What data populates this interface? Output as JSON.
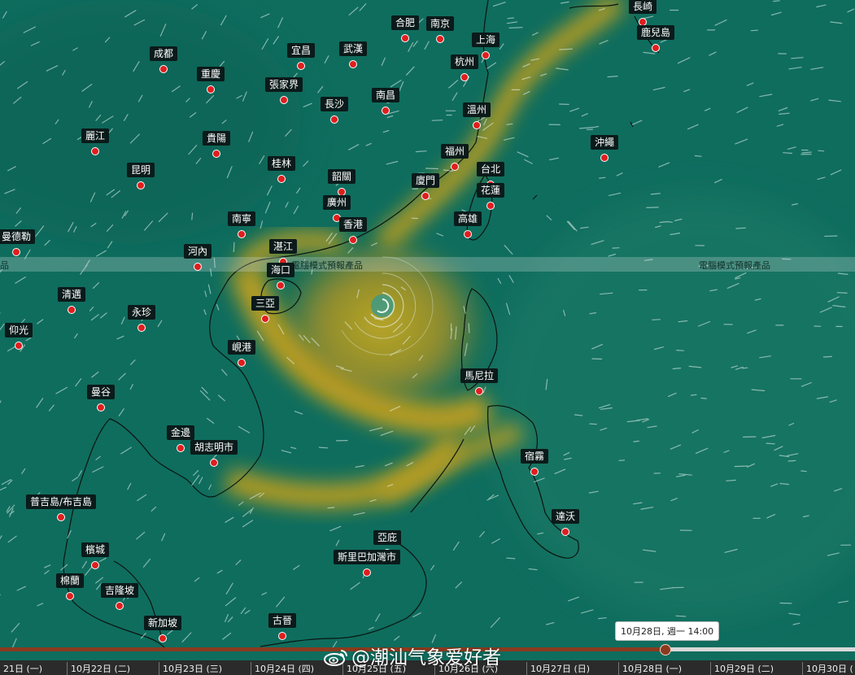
{
  "colors": {
    "ocean": "#0f6d5e",
    "strong_wind": "#c9a21a",
    "city_dot": "#e01e1e",
    "label_bg": "#0b1a1a",
    "timeline_played": "#8a3a1e"
  },
  "banner": {
    "left_text": "電腦模式預報產品",
    "right_text": "電腦模式預報產品",
    "edge_text": "品"
  },
  "cities": [
    {
      "name": "合肥"
    },
    {
      "name": "南京"
    },
    {
      "name": "長崎"
    },
    {
      "name": "鹿兒島"
    },
    {
      "name": "上海"
    },
    {
      "name": "成都"
    },
    {
      "name": "宜昌"
    },
    {
      "name": "武漢"
    },
    {
      "name": "杭州"
    },
    {
      "name": "重慶"
    },
    {
      "name": "張家界"
    },
    {
      "name": "南昌"
    },
    {
      "name": "長沙"
    },
    {
      "name": "溫州"
    },
    {
      "name": "麗江"
    },
    {
      "name": "貴陽"
    },
    {
      "name": "沖繩"
    },
    {
      "name": "福州"
    },
    {
      "name": "昆明"
    },
    {
      "name": "桂林"
    },
    {
      "name": "韶關"
    },
    {
      "name": "台北"
    },
    {
      "name": "廈門"
    },
    {
      "name": "廣州"
    },
    {
      "name": "花蓮"
    },
    {
      "name": "南寧"
    },
    {
      "name": "香港"
    },
    {
      "name": "高雄"
    },
    {
      "name": "曼德勒"
    },
    {
      "name": "河內"
    },
    {
      "name": "湛江"
    },
    {
      "name": "海口"
    },
    {
      "name": "清邁"
    },
    {
      "name": "三亞"
    },
    {
      "name": "永珍"
    },
    {
      "name": "仰光"
    },
    {
      "name": "峴港"
    },
    {
      "name": "馬尼拉"
    },
    {
      "name": "曼谷"
    },
    {
      "name": "金邊"
    },
    {
      "name": "胡志明市"
    },
    {
      "name": "宿霧"
    },
    {
      "name": "普吉島/布吉島"
    },
    {
      "name": "達沃"
    },
    {
      "name": "亞庇"
    },
    {
      "name": "檳城"
    },
    {
      "name": "斯里巴加灣市"
    },
    {
      "name": "棉蘭"
    },
    {
      "name": "吉隆坡"
    },
    {
      "name": "新加坡"
    },
    {
      "name": "古晉"
    }
  ],
  "timeline": {
    "tooltip": "10月28日, 週一 14:00",
    "progress_fraction": 0.778,
    "days": [
      "21日 (一)",
      "10月22日 (二)",
      "10月23日 (三)",
      "10月24日 (四)",
      "10月25日 (五)",
      "10月26日 (六)",
      "10月27日 (日)",
      "10月28日 (一)",
      "10月29日 (二)",
      "10月30日 ("
    ]
  },
  "watermark": {
    "text": "@潮汕气象爱好者",
    "icon": "weibo-icon"
  },
  "typhoon": {
    "icon": "typhoon-eye-icon"
  }
}
